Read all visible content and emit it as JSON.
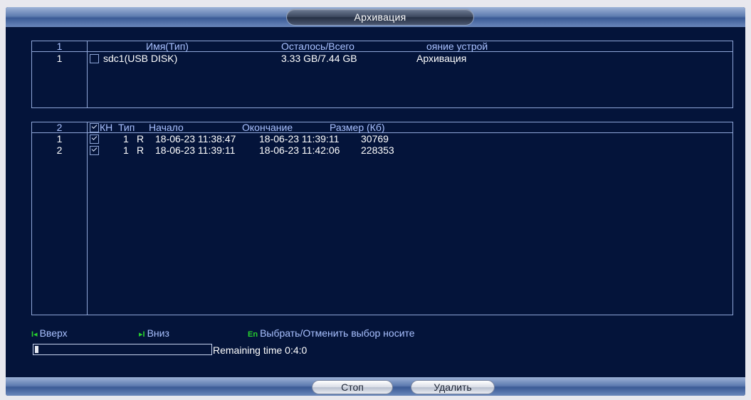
{
  "window": {
    "title": "Архивация"
  },
  "device_table": {
    "headers": {
      "index": "1",
      "name": "Имя(Тип)",
      "remaining": "Осталось/Всего",
      "state": "ояние устрой"
    },
    "rows": [
      {
        "index": "1",
        "checked": false,
        "name": "sdc1(USB DISK)",
        "remaining": "3.33 GB/7.44 GB",
        "state": "Архивация"
      }
    ]
  },
  "file_table": {
    "headers": {
      "index": "2",
      "channel": "КН",
      "type": "Тип",
      "start": "Начало",
      "end": "Окончание",
      "size": "Размер (Кб)"
    },
    "header_checked": true,
    "rows": [
      {
        "index": "1",
        "checked": true,
        "channel": "1",
        "type": "R",
        "start": "18-06-23 11:38:47",
        "end": "18-06-23 11:39:11",
        "size": "30769"
      },
      {
        "index": "2",
        "checked": true,
        "channel": "1",
        "type": "R",
        "start": "18-06-23 11:39:11",
        "end": "18-06-23 11:42:06",
        "size": "228353"
      }
    ]
  },
  "hints": {
    "up_key": "I◂",
    "up_label": "Вверх",
    "down_key": "▸I",
    "down_label": "Вниз",
    "select_key": "En",
    "select_label": "Выбрать/Отменить выбор носите"
  },
  "progress": {
    "fraction": 0.02,
    "remaining_text": "Remaining time 0:4:0"
  },
  "buttons": {
    "stop": "Стоп",
    "delete": "Удалить"
  },
  "colors": {
    "background": "#04143a",
    "header_text": "#a9c1ff",
    "hint_key": "#27d12e",
    "border": "#8fa6d8"
  }
}
